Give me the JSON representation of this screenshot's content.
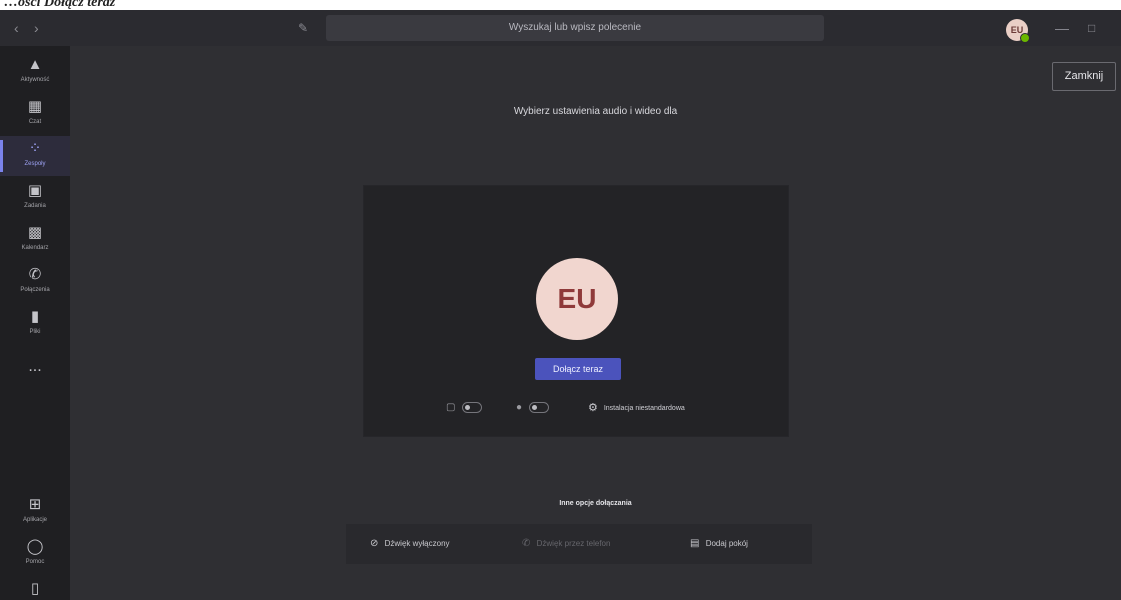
{
  "caption": {
    "text": "…ości Dołącz teraz"
  },
  "titlebar": {
    "search_placeholder": "Wyszukaj lub wpisz polecenie",
    "avatar_initials": "EU",
    "icons": [
      "back-icon",
      "forward-icon",
      "compose-icon",
      "minimize-icon",
      "maximize-icon"
    ]
  },
  "rail": {
    "items": [
      {
        "label": "Aktywność",
        "icon": "bell-icon"
      },
      {
        "label": "Czat",
        "icon": "chat-icon"
      },
      {
        "label": "Zespoły",
        "icon": "teams-icon",
        "active": true
      },
      {
        "label": "Zadania",
        "icon": "tasks-icon"
      },
      {
        "label": "Kalendarz",
        "icon": "calendar-icon"
      },
      {
        "label": "Połączenia",
        "icon": "phone-icon"
      },
      {
        "label": "Pliki",
        "icon": "files-icon"
      }
    ],
    "more": "...",
    "bottom": [
      {
        "label": "Aplikacje",
        "icon": "apps-icon"
      },
      {
        "label": "Pomoc",
        "icon": "help-icon"
      }
    ]
  },
  "main": {
    "close_label": "Zamknij",
    "heading": "Wybierz ustawienia audio i wideo dla",
    "avatar_initials": "EU",
    "join_label": "Dołącz teraz",
    "custom_setup_label": "Instalacja niestandardowa",
    "other_options": {
      "title": "Inne opcje dołączania",
      "audio_off": "Dźwięk wyłączony",
      "phone_audio": "Dźwięk przez telefon",
      "add_room": "Dodaj pokój"
    }
  },
  "colors": {
    "accent": "#4b53bc",
    "rail_active": "#7b83eb",
    "background": "#2f2f33"
  }
}
